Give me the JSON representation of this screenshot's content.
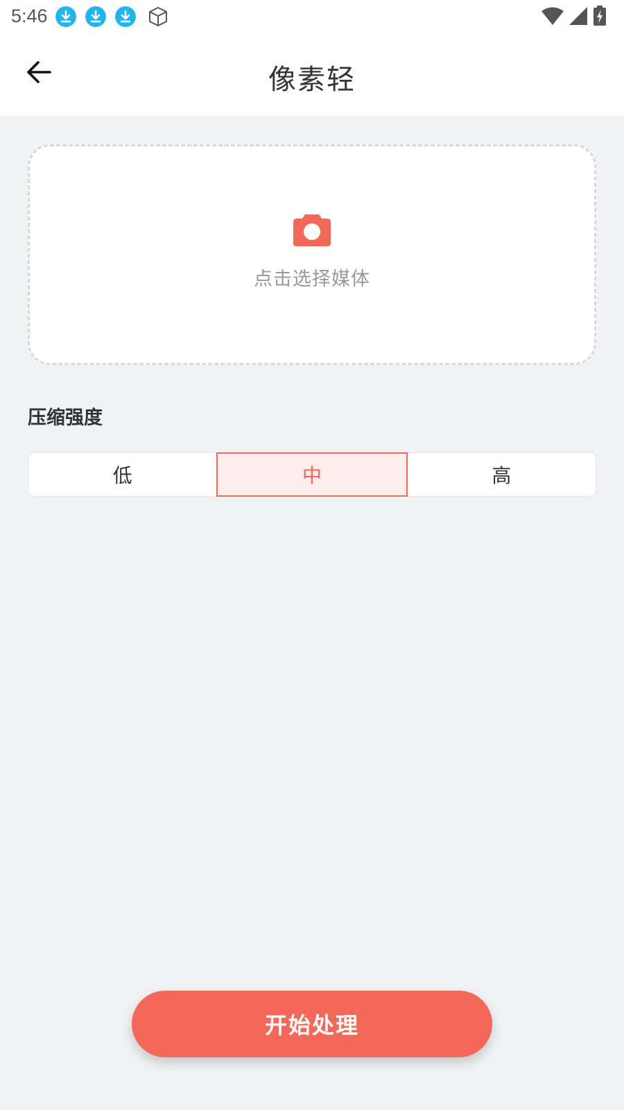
{
  "status_bar": {
    "time": "5:46",
    "icons": [
      "download-icon",
      "download-icon",
      "download-icon",
      "cube-icon",
      "wifi-icon",
      "signal-icon",
      "battery-charging-icon"
    ]
  },
  "app_bar": {
    "title": "像素轻",
    "back_icon": "arrow-left-icon"
  },
  "upload": {
    "icon": "camera-icon",
    "hint": "点击选择媒体"
  },
  "compression": {
    "label": "压缩强度",
    "options": [
      "低",
      "中",
      "高"
    ],
    "selected": "中"
  },
  "actions": {
    "start_label": "开始处理"
  },
  "colors": {
    "accent": "#f4685a",
    "download_icon": "#1fb6f0",
    "background": "#f1f2f4"
  }
}
